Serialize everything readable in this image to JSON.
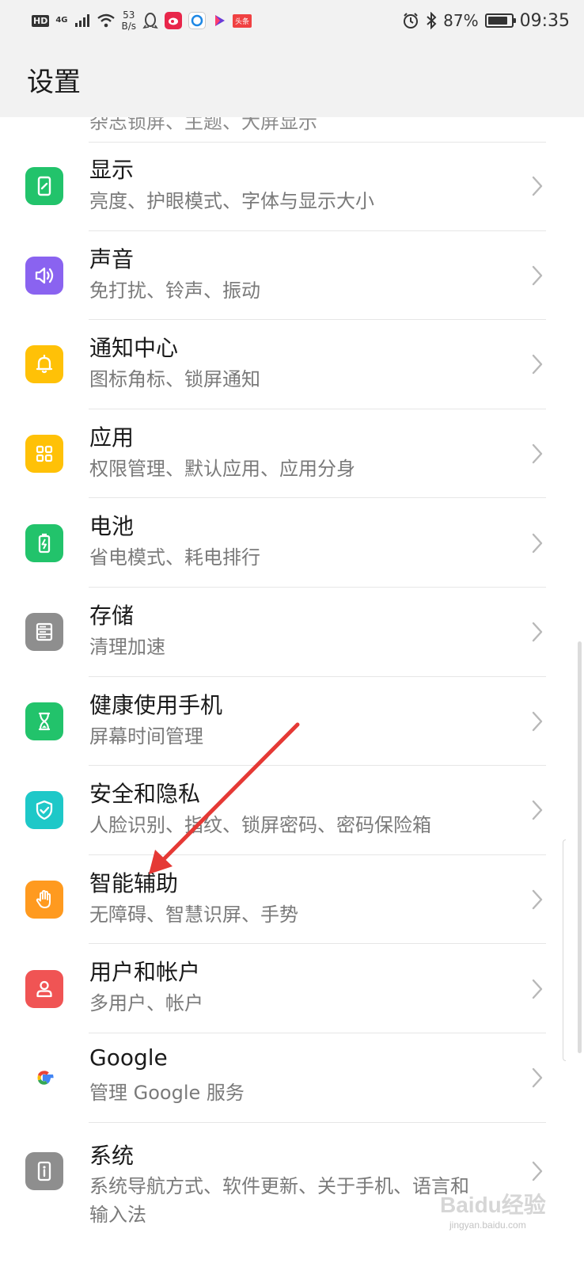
{
  "status_bar": {
    "hd": "HD",
    "network": "4G",
    "speed_value": "53",
    "speed_unit": "B/s",
    "toutiao_label": "头条",
    "battery_percent": "87%",
    "battery_level": 0.87,
    "time": "09:35"
  },
  "header": {
    "title": "设置"
  },
  "partial_item": {
    "subtitle": "杂志锁屏、主题、大屏显示"
  },
  "items": [
    {
      "title": "显示",
      "subtitle": "亮度、护眼模式、字体与显示大小",
      "icon": "display-icon",
      "color": "#22c36b"
    },
    {
      "title": "声音",
      "subtitle": "免打扰、铃声、振动",
      "icon": "sound-icon",
      "color": "#8a63f0"
    },
    {
      "title": "通知中心",
      "subtitle": "图标角标、锁屏通知",
      "icon": "bell-icon",
      "color": "#ffc107"
    },
    {
      "title": "应用",
      "subtitle": "权限管理、默认应用、应用分身",
      "icon": "apps-grid-icon",
      "color": "#ffc107"
    },
    {
      "title": "电池",
      "subtitle": "省电模式、耗电排行",
      "icon": "battery-icon",
      "color": "#22c36b"
    },
    {
      "title": "存储",
      "subtitle": "清理加速",
      "icon": "storage-icon",
      "color": "#8e8e8e"
    },
    {
      "title": "健康使用手机",
      "subtitle": "屏幕时间管理",
      "icon": "hourglass-icon",
      "color": "#22c36b"
    },
    {
      "title": "安全和隐私",
      "subtitle": "人脸识别、指纹、锁屏密码、密码保险箱",
      "icon": "shield-check-icon",
      "color": "#1ec8c8"
    },
    {
      "title": "智能辅助",
      "subtitle": "无障碍、智慧识屏、手势",
      "icon": "hand-icon",
      "color": "#ff9a1f"
    },
    {
      "title": "用户和帐户",
      "subtitle": "多用户、帐户",
      "icon": "user-icon",
      "color": "#f05454"
    },
    {
      "title": "Google",
      "subtitle": "管理 Google 服务",
      "icon": "google-icon",
      "color": "#ffffff"
    },
    {
      "title": "系统",
      "subtitle": "系统导航方式、软件更新、关于手机、语言和",
      "subtitle_line2": "输入法",
      "icon": "system-info-icon",
      "color": "#8e8e8e"
    }
  ],
  "watermark": {
    "brand": "Baidu经验",
    "url": "jingyan.baidu.com"
  },
  "annotation": {
    "arrow_color": "#e53935"
  }
}
